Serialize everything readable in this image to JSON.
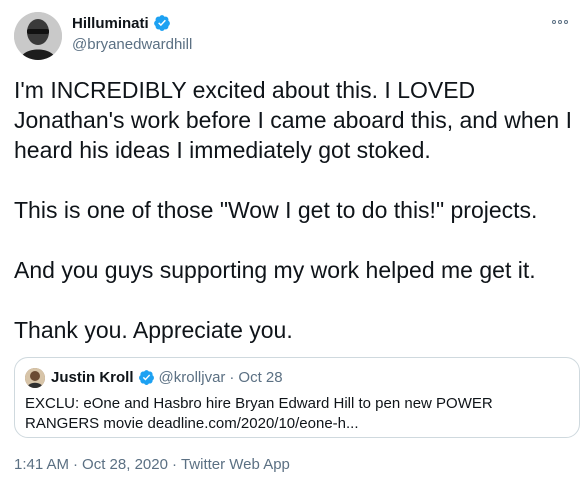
{
  "author": {
    "display_name": "Hilluminati",
    "handle": "@bryanedwardhill",
    "verified_icon": "verified-badge-icon"
  },
  "tweet": {
    "paragraphs": [
      "I'm INCREDIBLY excited about this. I LOVED Jonathan's work before I came aboard this, and when I heard his ideas I immediately got stoked.",
      "This is one of those \"Wow I get to do this!\" projects.",
      "And you guys supporting my work helped me get it.",
      "Thank you. Appreciate you."
    ]
  },
  "quoted": {
    "display_name": "Justin Kroll",
    "handle": "@krolljvar",
    "separator": "·",
    "date": "Oct 28",
    "text": "EXCLU: eOne and Hasbro hire Bryan Edward Hill to pen new POWER RANGERS movie deadline.com/2020/10/eone-h..."
  },
  "footer": {
    "time": "1:41 AM",
    "sep1": "·",
    "date": "Oct 28, 2020",
    "sep2": "·",
    "source": "Twitter Web App"
  },
  "colors": {
    "verified": "#1da1f2",
    "muted": "#5b7083",
    "border": "#cfd9de"
  }
}
